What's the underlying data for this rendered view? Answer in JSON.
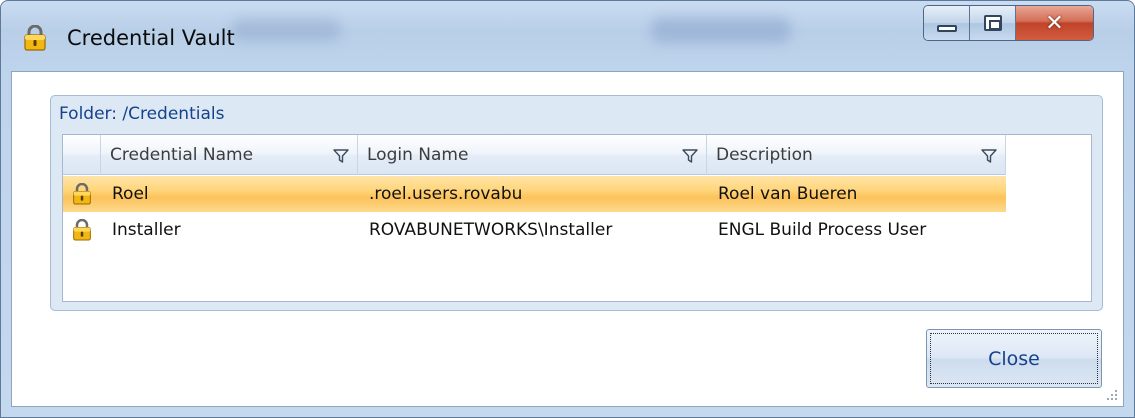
{
  "window": {
    "title": "Credential Vault",
    "buttons": {
      "minimize": "minimize",
      "maximize": "maximize",
      "close": "close"
    }
  },
  "group": {
    "header": "Folder: /Credentials"
  },
  "grid": {
    "columns": [
      "Credential Name",
      "Login Name",
      "Description"
    ],
    "rows": [
      {
        "name": "Roel",
        "login": ".roel.users.rovabu",
        "description": "Roel van Bueren",
        "selected": true,
        "icon": "lock-icon"
      },
      {
        "name": "Installer",
        "login": "ROVABUNETWORKS\\Installer",
        "description": "ENGL Build Process User",
        "selected": false,
        "icon": "lock-icon"
      }
    ]
  },
  "footer": {
    "close_label": "Close"
  },
  "colors": {
    "header_text": "#15428b",
    "selection": "#fcc25b",
    "window_frame": "#bed4ec"
  }
}
